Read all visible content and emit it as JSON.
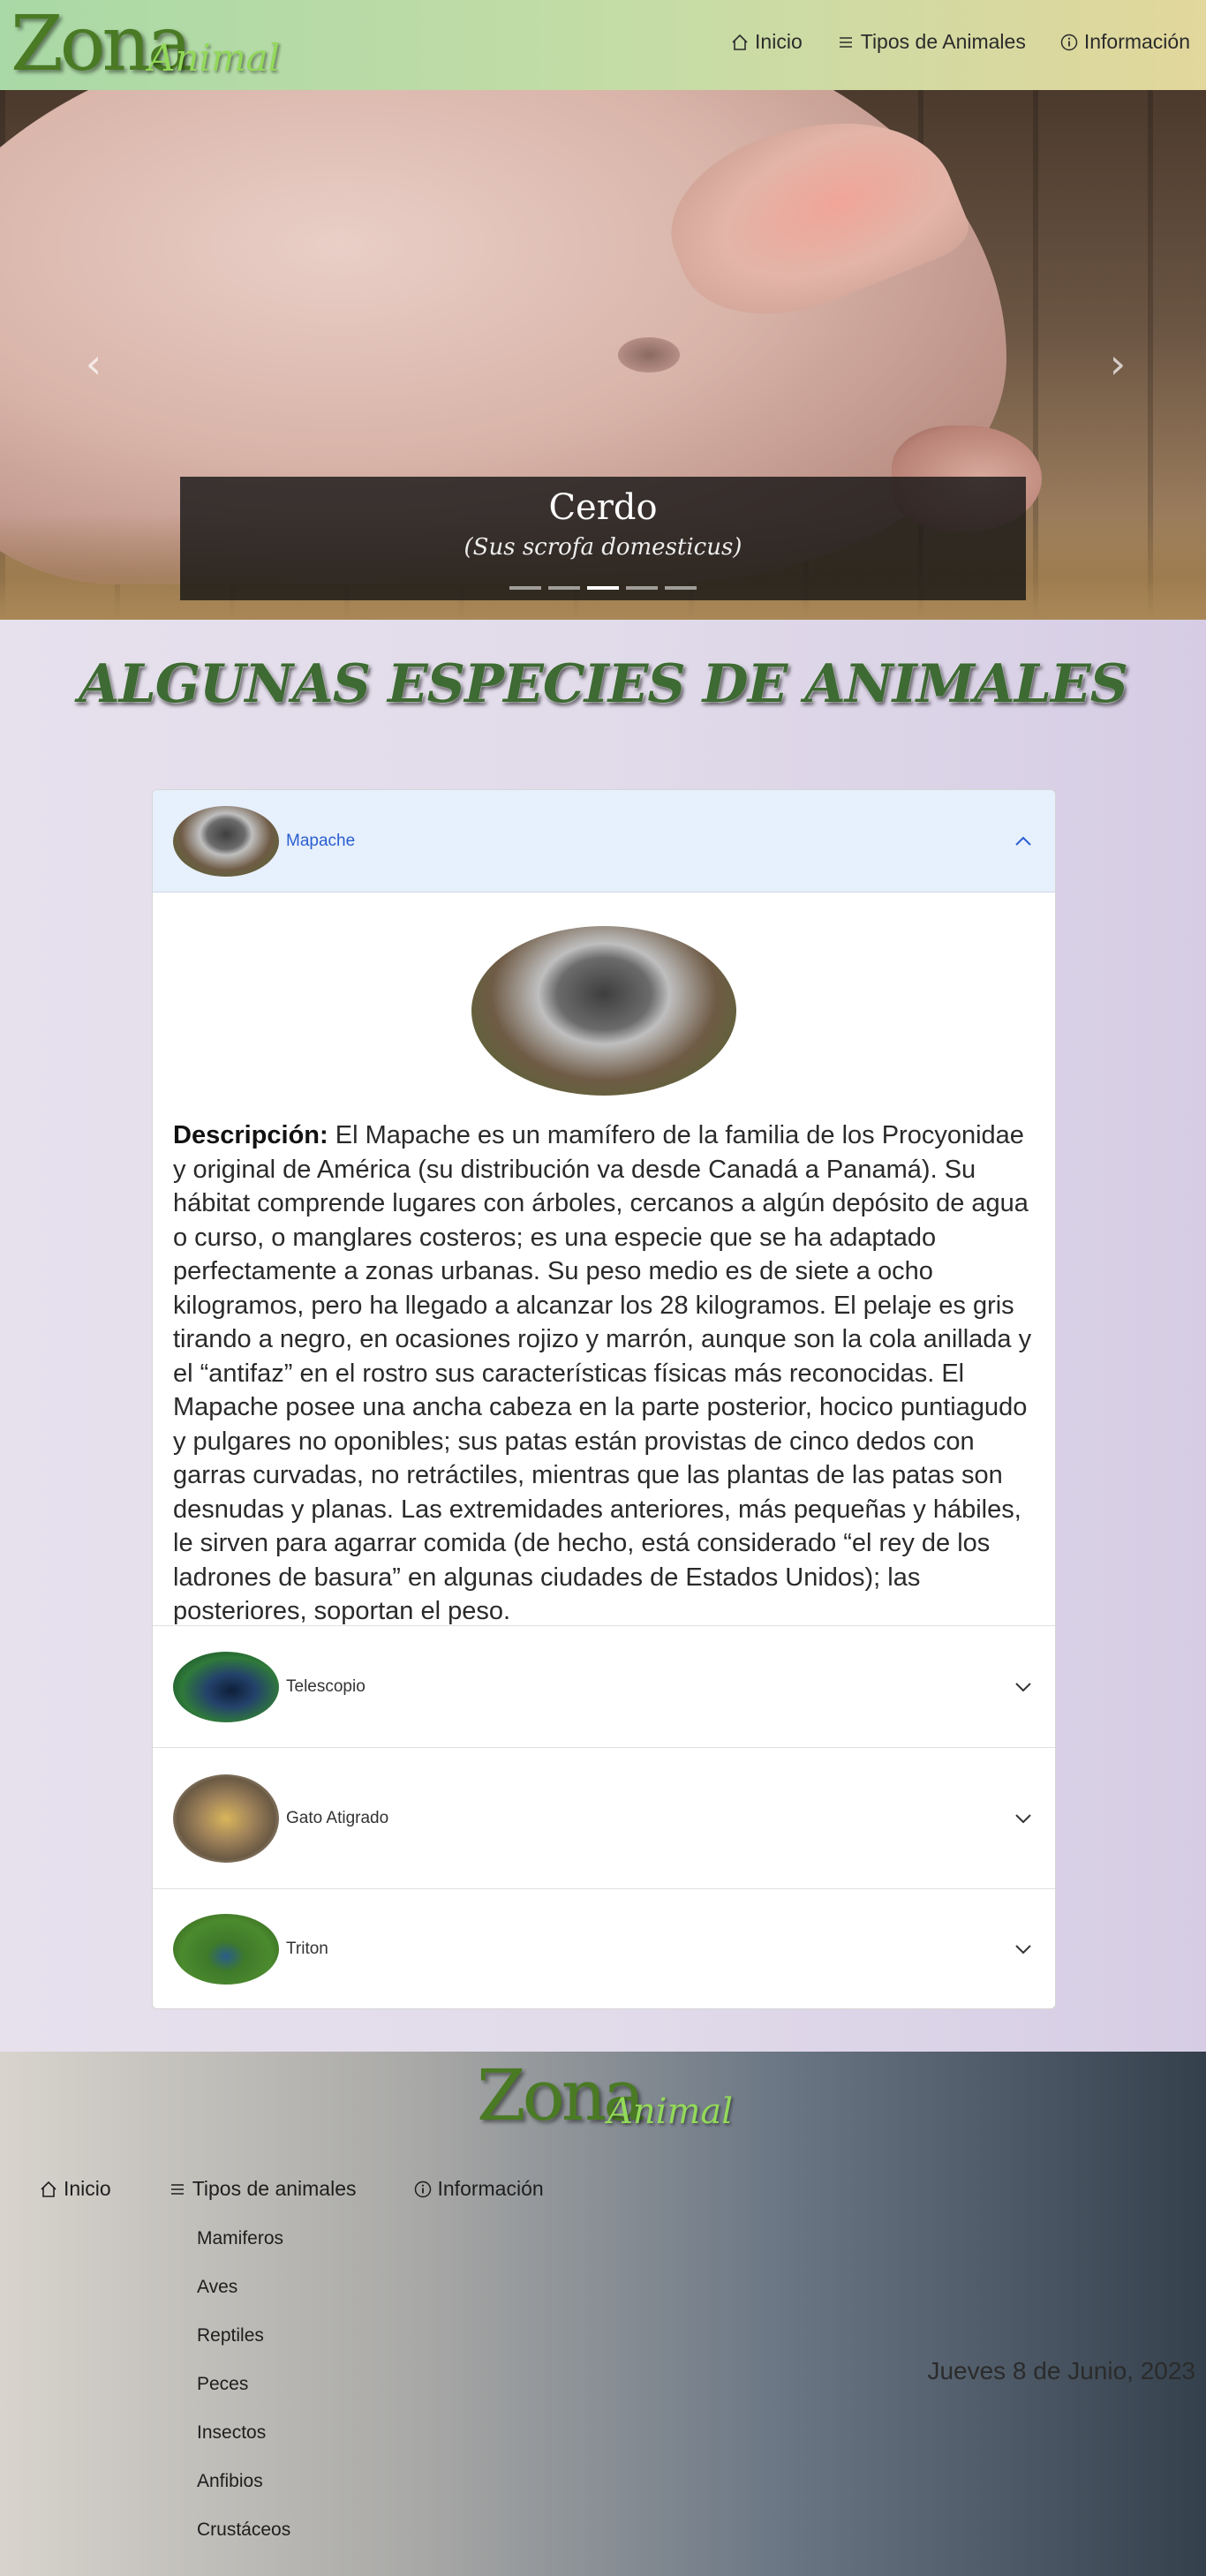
{
  "navbar": {
    "brand_main": "Zona",
    "brand_sub": "Animal",
    "links": [
      {
        "label": "Inicio",
        "icon": "home-icon"
      },
      {
        "label": "Tipos de Animales",
        "icon": "list-icon"
      },
      {
        "label": "Información",
        "icon": "info-icon"
      }
    ]
  },
  "carousel": {
    "slide_title": "Cerdo",
    "slide_subtitle": "(Sus scrofa domesticus)",
    "indicator_count": 5,
    "active_indicator": 3
  },
  "main": {
    "section_title": "ALGUNAS ESPECIES DE ANIMALES",
    "accordion": [
      {
        "label": "Mapache",
        "expanded": true,
        "description_label": "Descripción:",
        "description": "El Mapache es un mamífero de la familia de los Procyonidae y original de América (su distribución va desde Canadá a Panamá). Su hábitat comprende lugares con árboles, cercanos a algún depósito de agua o curso, o manglares costeros; es una especie que se ha adaptado perfectamente a zonas urbanas. Su peso medio es de siete a ocho kilogramos, pero ha llegado a alcanzar los 28 kilogramos. El pelaje es gris tirando a negro, en ocasiones rojizo y marrón, aunque son la cola anillada y el “antifaz” en el rostro sus características físicas más reconocidas. El Mapache posee una ancha cabeza en la parte posterior, hocico puntiagudo y pulgares no oponibles; sus patas están provistas de cinco dedos con garras curvadas, no retráctiles, mientras que las plantas de las patas son desnudas y planas. Las extremidades anteriores, más pequeñas y hábiles, le sirven para agarrar comida (de hecho, está considerado “el rey de los ladrones de basura” en algunas ciudades de Estados Unidos); las posteriores, soportan el peso."
      },
      {
        "label": "Telescopio",
        "expanded": false
      },
      {
        "label": "Gato Atigrado",
        "expanded": false
      },
      {
        "label": "Triton",
        "expanded": false
      }
    ]
  },
  "footer": {
    "brand_main": "Zona",
    "brand_sub": "Animal",
    "nav": [
      {
        "label": "Inicio",
        "icon": "home-icon"
      },
      {
        "label": "Tipos de animales",
        "icon": "list-icon"
      },
      {
        "label": "Información",
        "icon": "info-icon"
      }
    ],
    "animal_types": [
      "Mamiferos",
      "Aves",
      "Reptiles",
      "Peces",
      "Insectos",
      "Anfibios",
      "Crustáceos"
    ],
    "date": "Jueves 8 de Junio, 2023"
  },
  "colors": {
    "brand_green": "#4a7a24",
    "brand_light_green": "#93d95a",
    "accordion_active_bg": "#e7f0fd",
    "accordion_active_text": "#2a5fd0"
  }
}
